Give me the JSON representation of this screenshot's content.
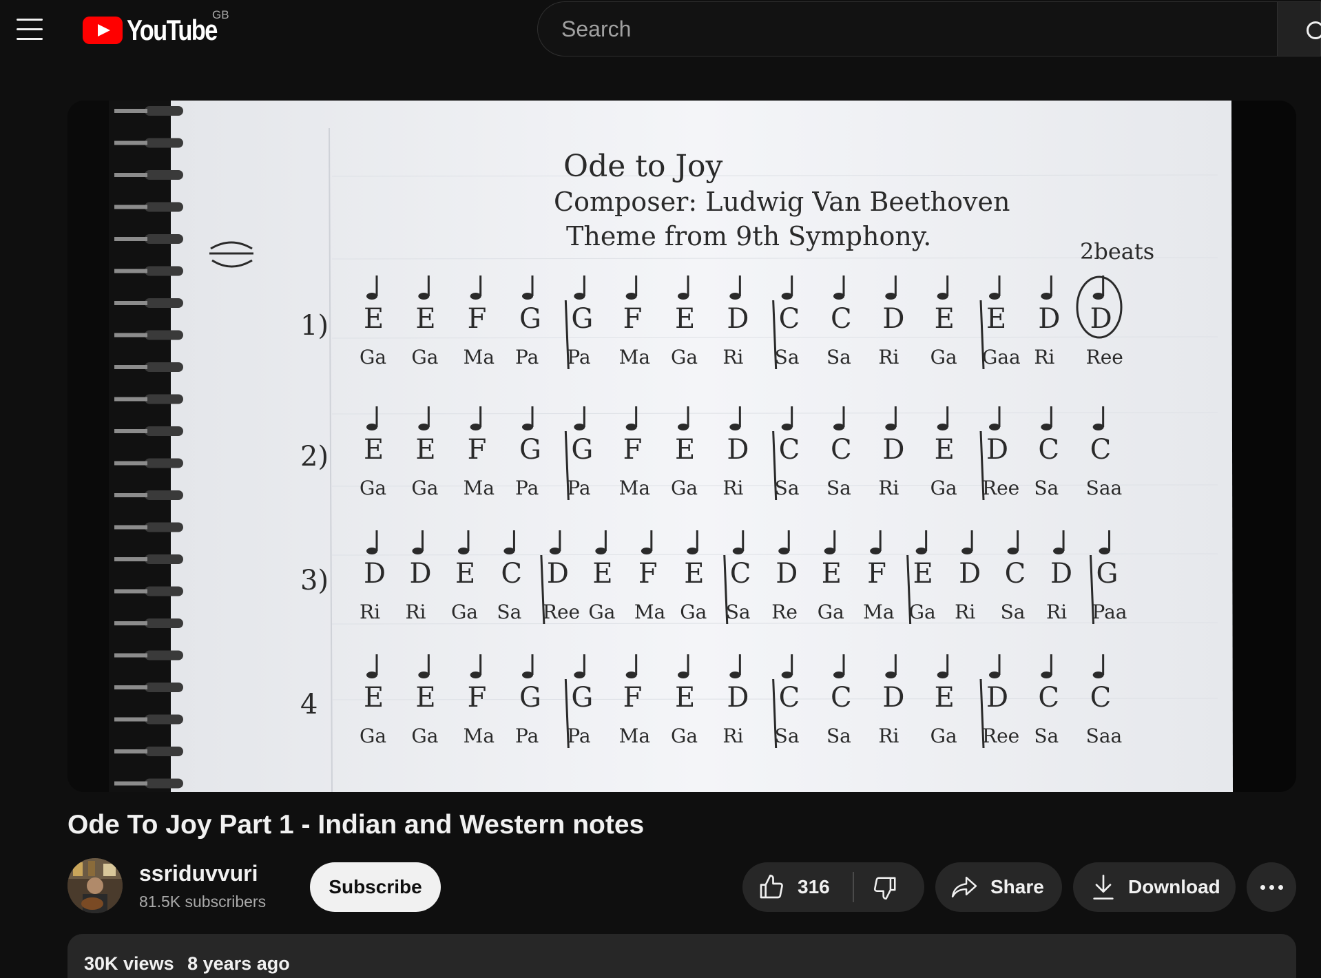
{
  "masthead": {
    "logo_text": "YouTube",
    "region": "GB",
    "search": {
      "placeholder": "Search",
      "value": ""
    }
  },
  "player": {
    "sheet": {
      "title_line": "Ode to Joy",
      "composer_line": "Composer: Ludwig Van Beethoven",
      "theme_line": "Theme from 9th Symphony.",
      "annotation": "2beats",
      "rows": [
        {
          "label": "1)",
          "western": [
            "E",
            "E",
            "F",
            "G",
            "G",
            "F",
            "E",
            "D",
            "C",
            "C",
            "D",
            "E",
            "E",
            "D",
            "D"
          ],
          "indian": [
            "Ga",
            "Ga",
            "Ma",
            "Pa",
            "Pa",
            "Ma",
            "Ga",
            "Ri",
            "Sa",
            "Sa",
            "Ri",
            "Ga",
            "Gaa",
            "Ri",
            "Ree"
          ]
        },
        {
          "label": "2)",
          "western": [
            "E",
            "E",
            "F",
            "G",
            "G",
            "F",
            "E",
            "D",
            "C",
            "C",
            "D",
            "E",
            "D",
            "C",
            "C"
          ],
          "indian": [
            "Ga",
            "Ga",
            "Ma",
            "Pa",
            "Pa",
            "Ma",
            "Ga",
            "Ri",
            "Sa",
            "Sa",
            "Ri",
            "Ga",
            "Ree",
            "Sa",
            "Saa"
          ]
        },
        {
          "label": "3)",
          "western": [
            "D",
            "D",
            "E",
            "C",
            "D",
            "E",
            "F",
            "E",
            "C",
            "D",
            "E",
            "F",
            "E",
            "D",
            "C",
            "D",
            "G"
          ],
          "indian": [
            "Ri",
            "Ri",
            "Ga",
            "Sa",
            "Ree",
            "Ga",
            "Ma",
            "Ga",
            "Sa",
            "Re",
            "Ga",
            "Ma",
            "Ga",
            "Ri",
            "Sa",
            "Ri",
            "Paa"
          ]
        },
        {
          "label": "4",
          "western": [
            "E",
            "E",
            "F",
            "G",
            "G",
            "F",
            "E",
            "D",
            "C",
            "C",
            "D",
            "E",
            "D",
            "C",
            "C"
          ],
          "indian": [
            "Ga",
            "Ga",
            "Ma",
            "Pa",
            "Pa",
            "Ma",
            "Ga",
            "Ri",
            "Sa",
            "Sa",
            "Ri",
            "Ga",
            "Ree",
            "Sa",
            "Saa"
          ]
        }
      ]
    }
  },
  "video": {
    "title": "Ode To Joy Part 1 - Indian and Western notes",
    "channel": {
      "name": "ssriduvvuri",
      "subscribers": "81.5K subscribers"
    },
    "subscribe_label": "Subscribe",
    "likes": "316",
    "share_label": "Share",
    "download_label": "Download",
    "views": "30K views",
    "age": "8 years ago"
  },
  "colors": {
    "background": "#0f0f0f",
    "logo_red": "#ff0000",
    "pill": "#272727",
    "subscribe_bg": "#f1f1f1",
    "paper": "#f2f3f6"
  },
  "icons": [
    "menu-icon",
    "youtube-logo-icon",
    "search-icon",
    "like-icon",
    "dislike-icon",
    "share-icon",
    "download-icon",
    "more-icon"
  ]
}
